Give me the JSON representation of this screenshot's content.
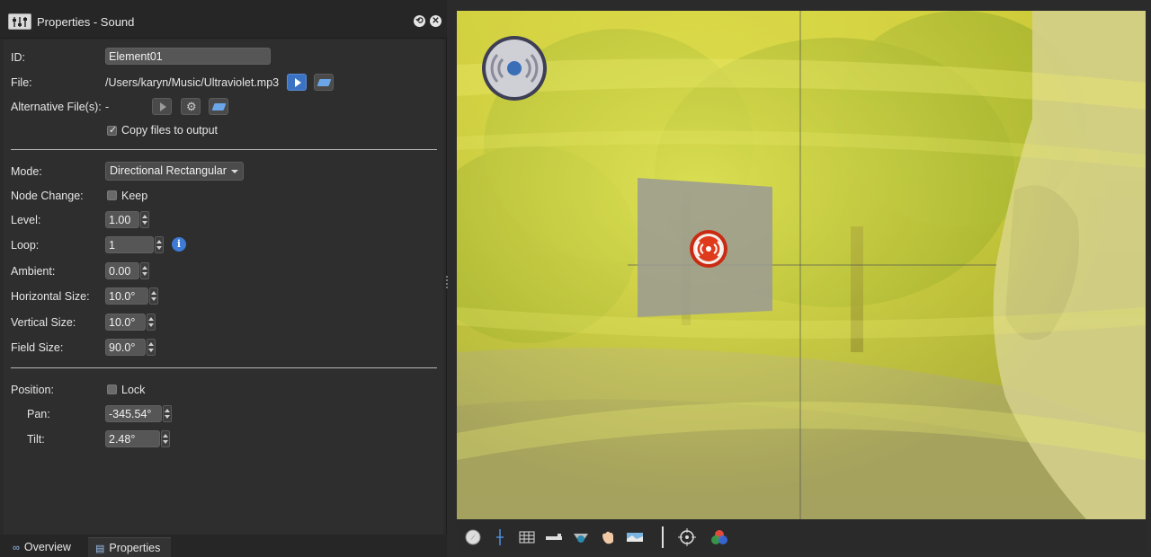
{
  "window": {
    "title": "Properties - Sound"
  },
  "form": {
    "id_label": "ID:",
    "id_value": "Element01",
    "file_label": "File:",
    "file_value": "/Users/karyn/Music/Ultraviolet.mp3",
    "alt_label": "Alternative File(s):",
    "alt_value": "-",
    "copy_label": "Copy files to output",
    "copy_checked": true,
    "mode_label": "Mode:",
    "mode_value": "Directional Rectangular",
    "node_change_label": "Node Change:",
    "keep_label": "Keep",
    "keep_checked": false,
    "level_label": "Level:",
    "level_value": "1.00",
    "loop_label": "Loop:",
    "loop_value": "1",
    "ambient_label": "Ambient:",
    "ambient_value": "0.00",
    "hsize_label": "Horizontal Size:",
    "hsize_value": "10.0°",
    "vsize_label": "Vertical Size:",
    "vsize_value": "10.0°",
    "fsize_label": "Field Size:",
    "fsize_value": "90.0°",
    "position_label": "Position:",
    "lock_label": "Lock",
    "lock_checked": false,
    "pan_label": "Pan:",
    "pan_value": "-345.54°",
    "tilt_label": "Tilt:",
    "tilt_value": "2.48°"
  },
  "tabs": [
    {
      "label": "Overview",
      "icon": "binoculars-icon"
    },
    {
      "label": "Properties",
      "icon": "properties-icon"
    }
  ],
  "viewer_toolbar": [
    "compass-icon",
    "crosshair-line-icon",
    "grid-icon",
    "ruler-icon",
    "eye-icon",
    "hand-icon",
    "panorama-icon",
    "target-icon",
    "color-circles-icon"
  ],
  "colors": {
    "accent": "#3b73c4",
    "overlay": "#e8e84a",
    "sound_marker": "#e03a1c"
  }
}
